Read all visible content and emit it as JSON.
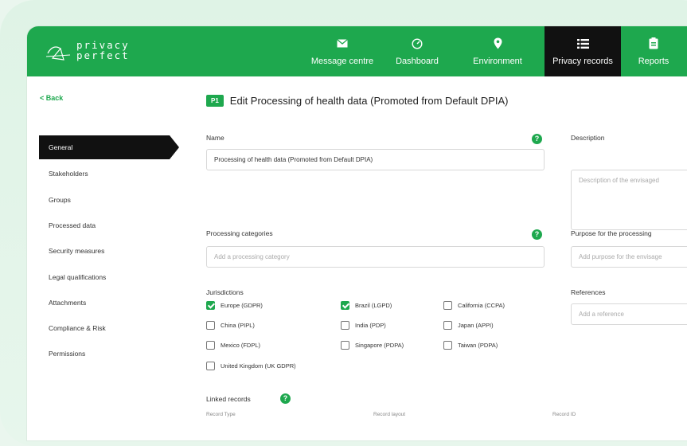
{
  "app": {
    "logo_line1": "privacy",
    "logo_line2": "perfect",
    "brand_color": "#1ea84e"
  },
  "nav": [
    {
      "label": "Message centre",
      "icon": "envelope-icon"
    },
    {
      "label": "Dashboard",
      "icon": "gauge-icon"
    },
    {
      "label": "Environment",
      "icon": "location-pin-icon"
    },
    {
      "label": "Privacy records",
      "icon": "list-icon",
      "active": true
    },
    {
      "label": "Reports",
      "icon": "clipboard-icon"
    }
  ],
  "sidebar": {
    "back_label": "< Back",
    "items": [
      "General",
      "Stakeholders",
      "Groups",
      "Processed data",
      "Security measures",
      "Legal qualifications",
      "Attachments",
      "Compliance & Risk",
      "Permissions"
    ],
    "active_index": 0
  },
  "page": {
    "badge": "P1",
    "title": "Edit Processing of health data (Promoted from Default DPIA)"
  },
  "form": {
    "name_label": "Name",
    "name_value": "Processing of health data (Promoted from Default DPIA)",
    "description_label": "Description",
    "description_placeholder": "Description of the envisaged",
    "categories_label": "Processing categories",
    "categories_placeholder": "Add a processing category",
    "purpose_label": "Purpose for the processing",
    "purpose_placeholder": "Add purpose for the envisage",
    "jurisdictions_label": "Jurisdictions",
    "references_label": "References",
    "references_placeholder": "Add a reference",
    "help_glyph": "?"
  },
  "jurisdictions": [
    {
      "label": "Europe (GDPR)",
      "checked": true
    },
    {
      "label": "Brazil (LGPD)",
      "checked": true
    },
    {
      "label": "California (CCPA)",
      "checked": false
    },
    {
      "label": "China (PIPL)",
      "checked": false
    },
    {
      "label": "India (PDP)",
      "checked": false
    },
    {
      "label": "Japan (APPI)",
      "checked": false
    },
    {
      "label": "Mexico (FDPL)",
      "checked": false
    },
    {
      "label": "Singapore (PDPA)",
      "checked": false
    },
    {
      "label": "Taiwan (PDPA)",
      "checked": false
    },
    {
      "label": "United Kingdom (UK GDPR)",
      "checked": false
    }
  ],
  "linked": {
    "label": "Linked records",
    "columns": [
      "Record Type",
      "Record layout",
      "Record ID"
    ]
  }
}
